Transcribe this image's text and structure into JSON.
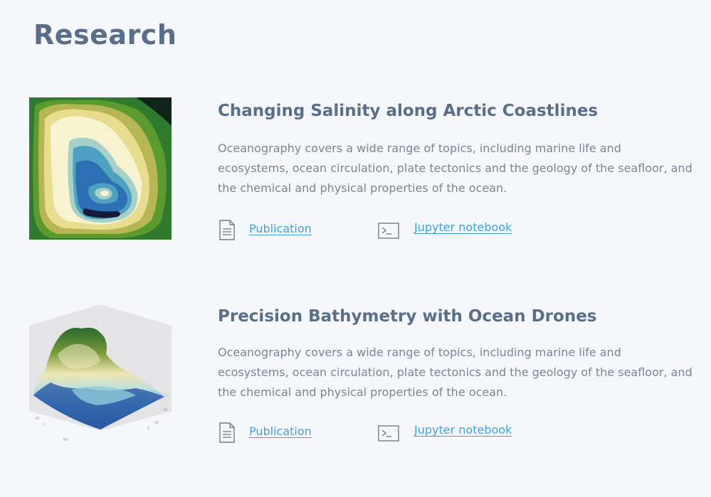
{
  "page": {
    "title": "Research"
  },
  "projects": [
    {
      "title": "Changing Salinity along Arctic Coastlines",
      "description": "Oceanography covers a wide range of topics, including marine life and ecosystems, ocean circulation, plate tectonics and the geology of the seafloor, and the chemical and physical properties of the ocean.",
      "thumbnail": "salinity-contour-map",
      "links": {
        "publication": {
          "label": "Publication",
          "icon": "document-icon"
        },
        "notebook": {
          "label": "Jupyter notebook",
          "icon": "terminal-icon"
        }
      }
    },
    {
      "title": "Precision Bathymetry with Ocean Drones",
      "description": "Oceanography covers a wide range of topics, including marine life and ecosystems, ocean circulation, plate tectonics and the geology of the seafloor, and the chemical and physical properties of the ocean.",
      "thumbnail": "bathymetry-3d-surface",
      "links": {
        "publication": {
          "label": "Publication",
          "icon": "document-icon"
        },
        "notebook": {
          "label": "Jupyter notebook",
          "icon": "terminal-icon"
        }
      }
    }
  ],
  "colors": {
    "background": "#f5f7fa",
    "heading": "#5a6e8a",
    "body_text": "#7c8594",
    "link": "#3fa2e6",
    "icon": "#6f7a8a"
  }
}
